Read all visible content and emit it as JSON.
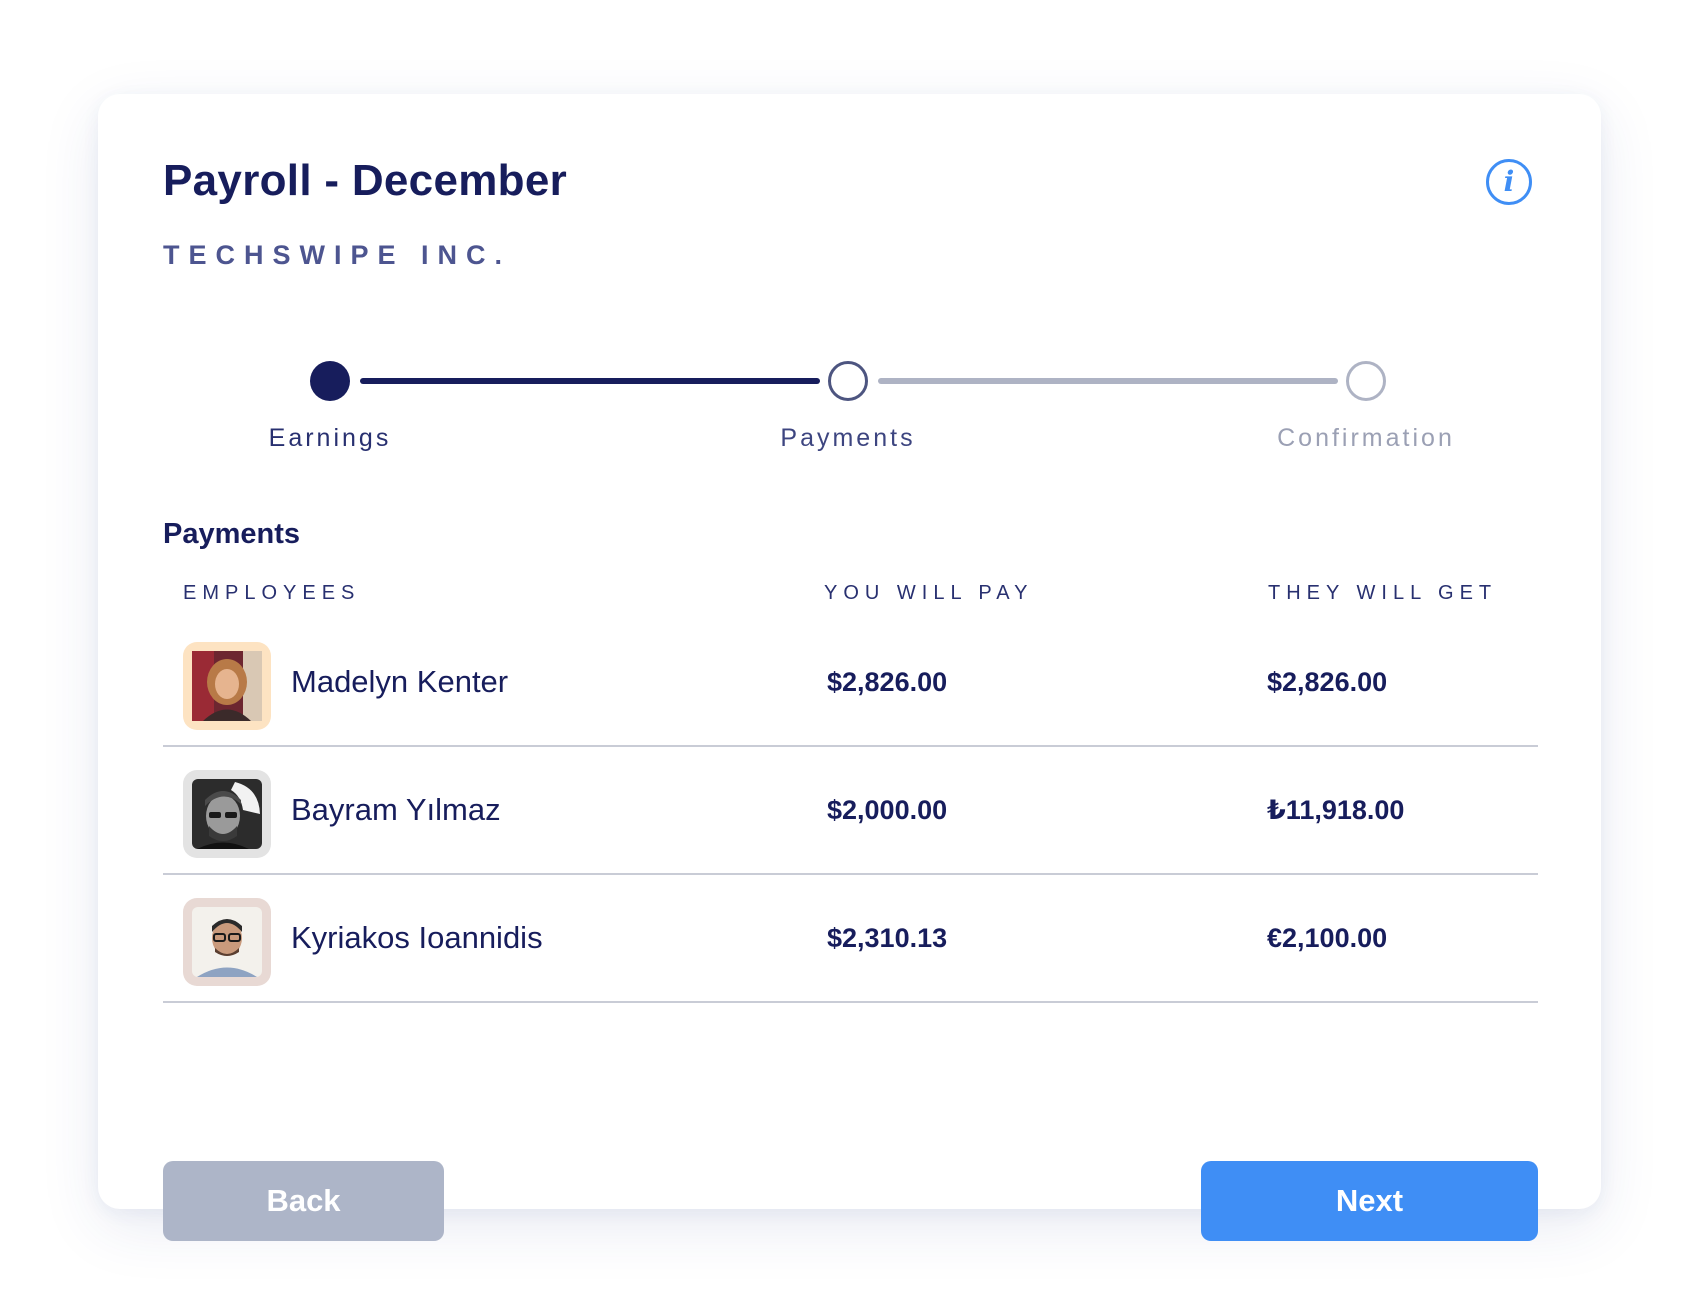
{
  "header": {
    "title": "Payroll - December",
    "company": "TECHSWIPE INC.",
    "info_icon": "info-icon"
  },
  "stepper": {
    "steps": [
      {
        "label": "Earnings",
        "state": "completed"
      },
      {
        "label": "Payments",
        "state": "current"
      },
      {
        "label": "Confirmation",
        "state": "upcoming"
      }
    ]
  },
  "payments": {
    "section_title": "Payments",
    "columns": [
      "EMPLOYEES",
      "YOU WILL PAY",
      "THEY WILL GET"
    ],
    "rows": [
      {
        "name": "Madelyn Kenter",
        "you_pay": "$2,826.00",
        "they_get": "$2,826.00"
      },
      {
        "name": "Bayram Yılmaz",
        "you_pay": "$2,000.00",
        "they_get": "₺11,918.00"
      },
      {
        "name": "Kyriakos Ioannidis",
        "you_pay": "$2,310.13",
        "they_get": "€2,100.00"
      }
    ]
  },
  "actions": {
    "back_label": "Back",
    "next_label": "Next"
  },
  "colors": {
    "primary_dark": "#171d5c",
    "accent_blue": "#3f8ef5",
    "muted_gray": "#adb5c8"
  }
}
